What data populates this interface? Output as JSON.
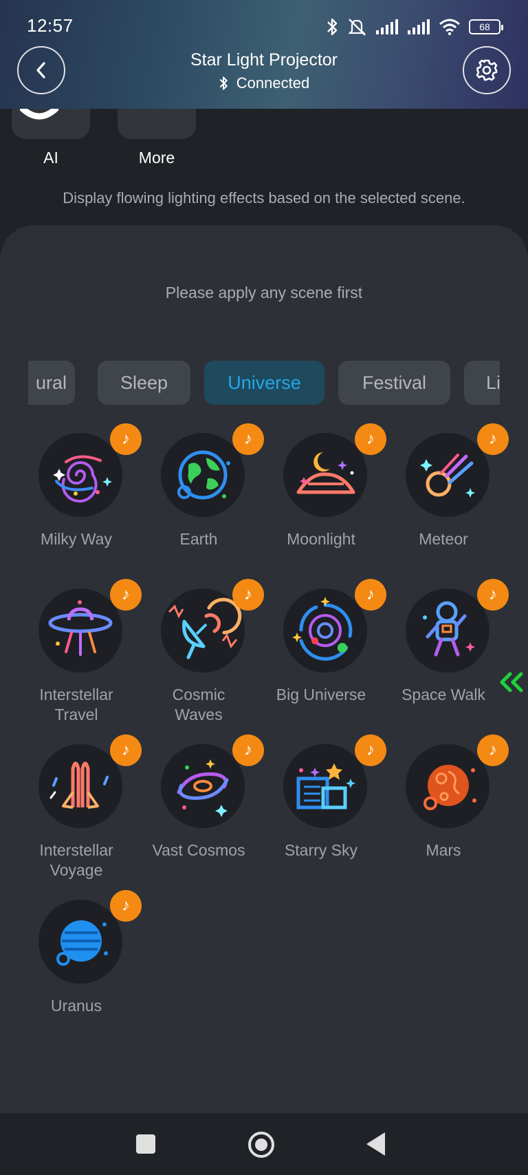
{
  "status_bar": {
    "time": "12:57",
    "battery": "68",
    "icons": [
      "bluetooth-icon",
      "mute-icon",
      "signal-icon",
      "signal-icon",
      "wifi-icon",
      "battery-icon"
    ]
  },
  "header": {
    "title": "Star Light Projector",
    "connection_status": "Connected",
    "back_icon": "chevron-left-icon",
    "settings_icon": "gear-icon"
  },
  "top_tiles": [
    {
      "label": "AI"
    },
    {
      "label": "More"
    }
  ],
  "description": "Display flowing lighting effects based on the selected scene.",
  "hint": "Please apply any scene first",
  "tabs": [
    {
      "label": "Natural",
      "visible_text": "ural",
      "active": false
    },
    {
      "label": "Sleep",
      "active": false
    },
    {
      "label": "Universe",
      "active": true
    },
    {
      "label": "Festival",
      "active": false
    },
    {
      "label": "Life",
      "visible_text": "Li",
      "active": false
    }
  ],
  "scenes": [
    {
      "label": "Milky Way",
      "icon": "galaxy-icon",
      "music": true
    },
    {
      "label": "Earth",
      "icon": "earth-icon",
      "music": true
    },
    {
      "label": "Moonlight",
      "icon": "moon-icon",
      "music": true
    },
    {
      "label": "Meteor",
      "icon": "meteor-icon",
      "music": true
    },
    {
      "label": "Interstellar Travel",
      "line1": "Interstellar",
      "line2": "Travel",
      "icon": "ufo-icon",
      "music": true
    },
    {
      "label": "Cosmic Waves",
      "line1": "Cosmic",
      "line2": "Waves",
      "icon": "satellite-dish-icon",
      "music": true
    },
    {
      "label": "Big Universe",
      "icon": "orbit-icon",
      "music": true
    },
    {
      "label": "Space Walk",
      "icon": "astronaut-icon",
      "music": true
    },
    {
      "label": "Interstellar Voyage",
      "line1": "Interstellar",
      "line2": "Voyage",
      "icon": "rocket-icon",
      "music": true
    },
    {
      "label": "Vast Cosmos",
      "icon": "spiral-galaxy-icon",
      "music": true
    },
    {
      "label": "Starry Sky",
      "icon": "city-stars-icon",
      "music": true
    },
    {
      "label": "Mars",
      "icon": "mars-icon",
      "music": true
    },
    {
      "label": "Uranus",
      "icon": "uranus-icon",
      "music": true
    }
  ],
  "music_badge_glyph": "♪",
  "colors": {
    "active_tab_text": "#22a8e8",
    "active_tab_bg": "#1f4a5e",
    "music_badge": "#f48a14",
    "panel_bg": "#2d3036",
    "page_bg": "#1f2227",
    "scroll_hint": "#1fd23a"
  },
  "nav_bar": [
    "recents-button",
    "home-button",
    "back-button"
  ]
}
